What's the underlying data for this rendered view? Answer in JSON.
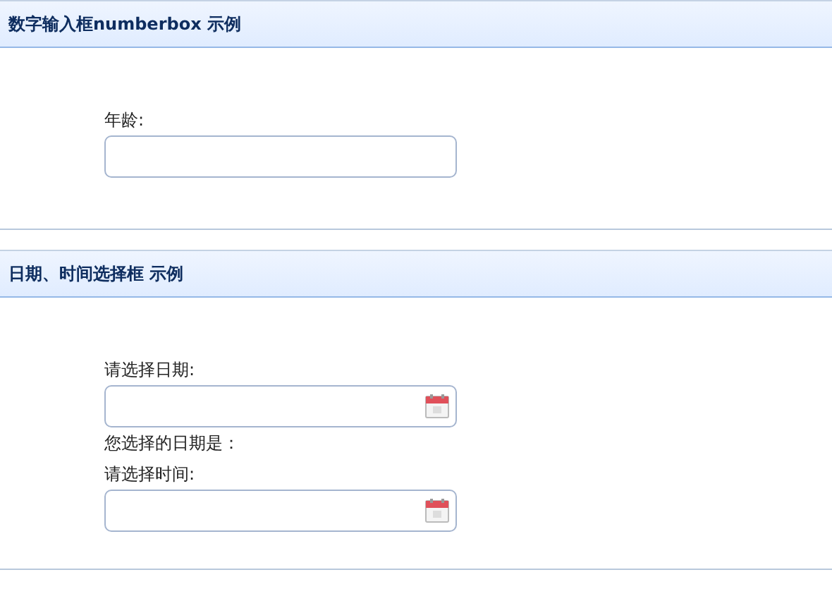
{
  "panels": [
    {
      "title": "数字输入框numberbox 示例",
      "items": [
        {
          "kind": "label",
          "text": "年龄:"
        },
        {
          "kind": "numberbox"
        }
      ]
    },
    {
      "title": "日期、时间选择框 示例",
      "items": [
        {
          "kind": "label",
          "text": "请选择日期:"
        },
        {
          "kind": "datebox"
        },
        {
          "kind": "note",
          "text": "您选择的日期是："
        },
        {
          "kind": "label",
          "text": "请选择时间:"
        },
        {
          "kind": "datebox"
        }
      ]
    }
  ]
}
